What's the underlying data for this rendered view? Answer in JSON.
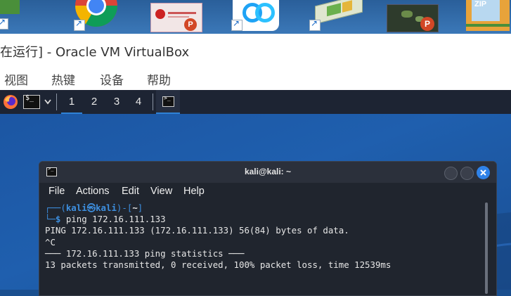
{
  "desktop": {
    "shortcuts": [
      {
        "name": "folder"
      },
      {
        "name": "chrome"
      },
      {
        "name": "ppt-document"
      },
      {
        "name": "baidu-netdisk"
      },
      {
        "name": "app"
      },
      {
        "name": "ppt-map"
      },
      {
        "name": "zip-archive"
      }
    ],
    "zip_label": "ZIP"
  },
  "virtualbox": {
    "title": "在运行] - Oracle VM VirtualBox",
    "menu": [
      "视图",
      "热键",
      "设备",
      "帮助"
    ]
  },
  "kali_panel": {
    "workspaces": [
      "1",
      "2",
      "3",
      "4"
    ],
    "active_workspace": "1"
  },
  "terminal": {
    "title": "kali@kali: ~",
    "menu": [
      "File",
      "Actions",
      "Edit",
      "View",
      "Help"
    ],
    "prompt": {
      "line1_prefix": "┌──(",
      "user": "kali",
      "at": "㉿",
      "host": "kali",
      "line1_mid": ")-[",
      "dir": "~",
      "line1_end": "]",
      "line2_prefix": "└─",
      "dollar": "$",
      "command": " ping 172.16.111.133"
    },
    "output": [
      "PING 172.16.111.133 (172.16.111.133) 56(84) bytes of data.",
      "^C",
      "─── 172.16.111.133 ping statistics ───",
      "13 packets transmitted, 0 received, 100% packet loss, time 12539ms"
    ]
  }
}
